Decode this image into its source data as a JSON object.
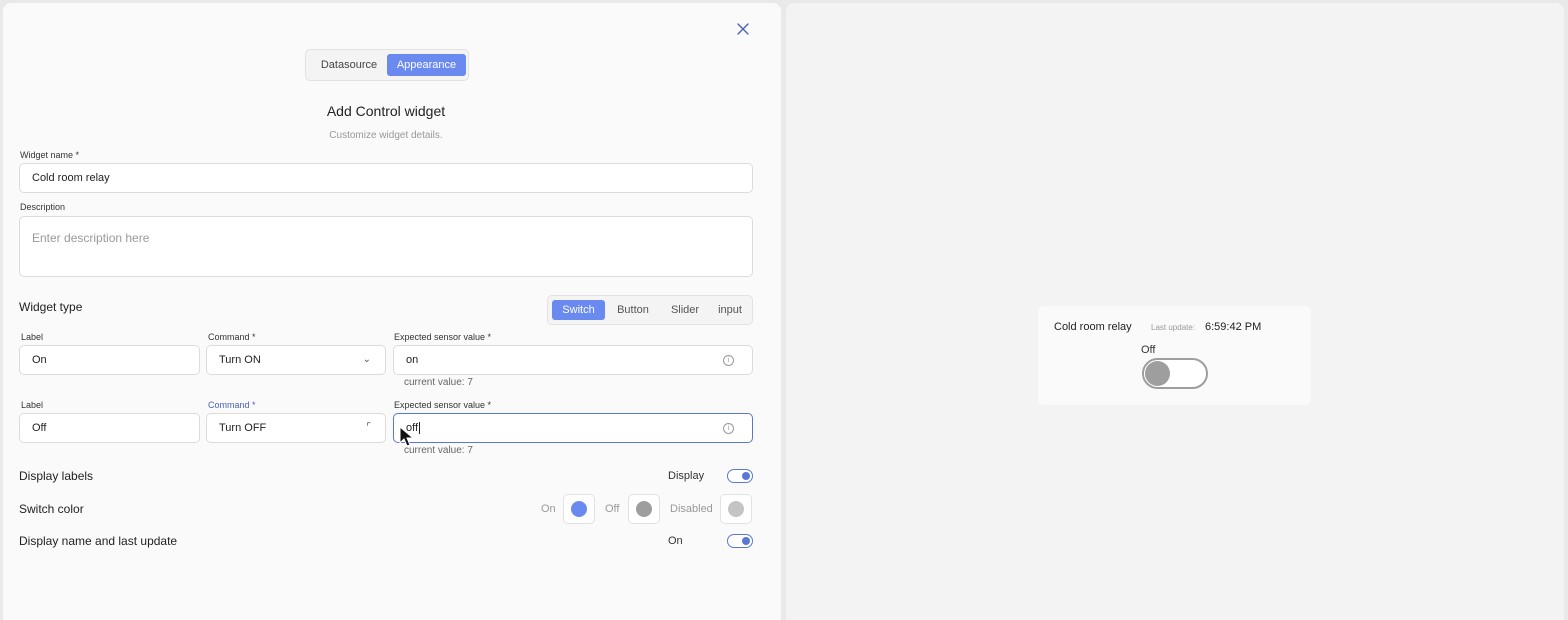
{
  "tabs": {
    "datasource": "Datasource",
    "appearance": "Appearance"
  },
  "header": {
    "title": "Add Control widget",
    "subtitle": "Customize widget details."
  },
  "widget_name": {
    "label": "Widget name *",
    "value": "Cold room relay"
  },
  "description": {
    "label": "Description",
    "placeholder": "Enter description here"
  },
  "widget_type": {
    "label": "Widget type",
    "options": [
      "Switch",
      "Button",
      "Slider",
      "input"
    ],
    "selected": "Switch"
  },
  "rows": [
    {
      "label_caption": "Label",
      "label_value": "On",
      "command_caption": "Command *",
      "command_value": "Turn ON",
      "sensor_caption": "Expected sensor value *",
      "sensor_value": "on",
      "current": "current value: 7"
    },
    {
      "label_caption": "Label",
      "label_value": "Off",
      "command_caption": "Command *",
      "command_value": "Turn OFF",
      "sensor_caption": "Expected sensor value *",
      "sensor_value": "off",
      "current": "current value: 7"
    }
  ],
  "display_labels": {
    "label": "Display labels",
    "state_text": "Display",
    "enabled": true
  },
  "switch_color": {
    "label": "Switch color",
    "on_label": "On",
    "on_color": "#6b8af0",
    "off_label": "Off",
    "off_color": "#9e9e9e",
    "disabled_label": "Disabled",
    "disabled_color": "#c4c4c4"
  },
  "display_name": {
    "label": "Display name and last update",
    "state_text": "On",
    "enabled": true
  },
  "preview": {
    "name": "Cold room relay",
    "last_update_label": "Last update:",
    "last_update_time": "6:59:42 PM",
    "state_label": "Off"
  },
  "colors": {
    "accent": "#6b8af0",
    "focus_border": "#5b77d6"
  }
}
